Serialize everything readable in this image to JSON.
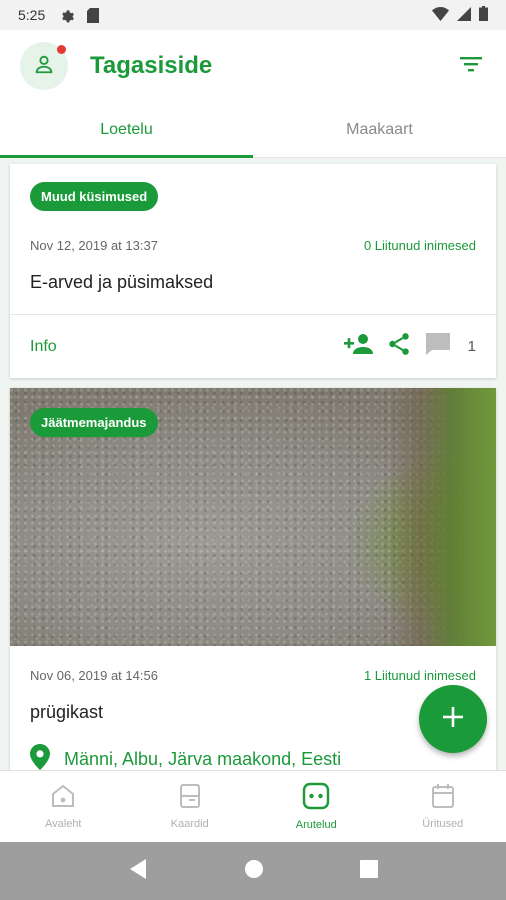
{
  "status_bar": {
    "time": "5:25"
  },
  "app_bar": {
    "title": "Tagasiside"
  },
  "tabs": [
    {
      "label": "Loetelu",
      "active": true
    },
    {
      "label": "Maakaart",
      "active": false
    }
  ],
  "cards": [
    {
      "category": "Muud küsimused",
      "date": "Nov 12, 2019 at 13:37",
      "joined": "0 Liitunud inimesed",
      "title": "E-arved ja püsimaksed",
      "info_label": "Info",
      "comment_count": "1"
    },
    {
      "category": "Jäätmemajandus",
      "date": "Nov 06, 2019 at 14:56",
      "joined": "1 Liitunud inimesed",
      "title": "prügikast",
      "location": "Männi, Albu, Järva maakond, Eesti"
    }
  ],
  "bottom_nav": [
    {
      "label": "Avaleht",
      "icon": "home-icon",
      "active": false
    },
    {
      "label": "Kaardid",
      "icon": "cards-icon",
      "active": false
    },
    {
      "label": "Arutelud",
      "icon": "discussion-icon",
      "active": true
    },
    {
      "label": "Üritused",
      "icon": "calendar-icon",
      "active": false
    }
  ],
  "colors": {
    "primary": "#1b9a3a",
    "notification": "#e53935"
  }
}
